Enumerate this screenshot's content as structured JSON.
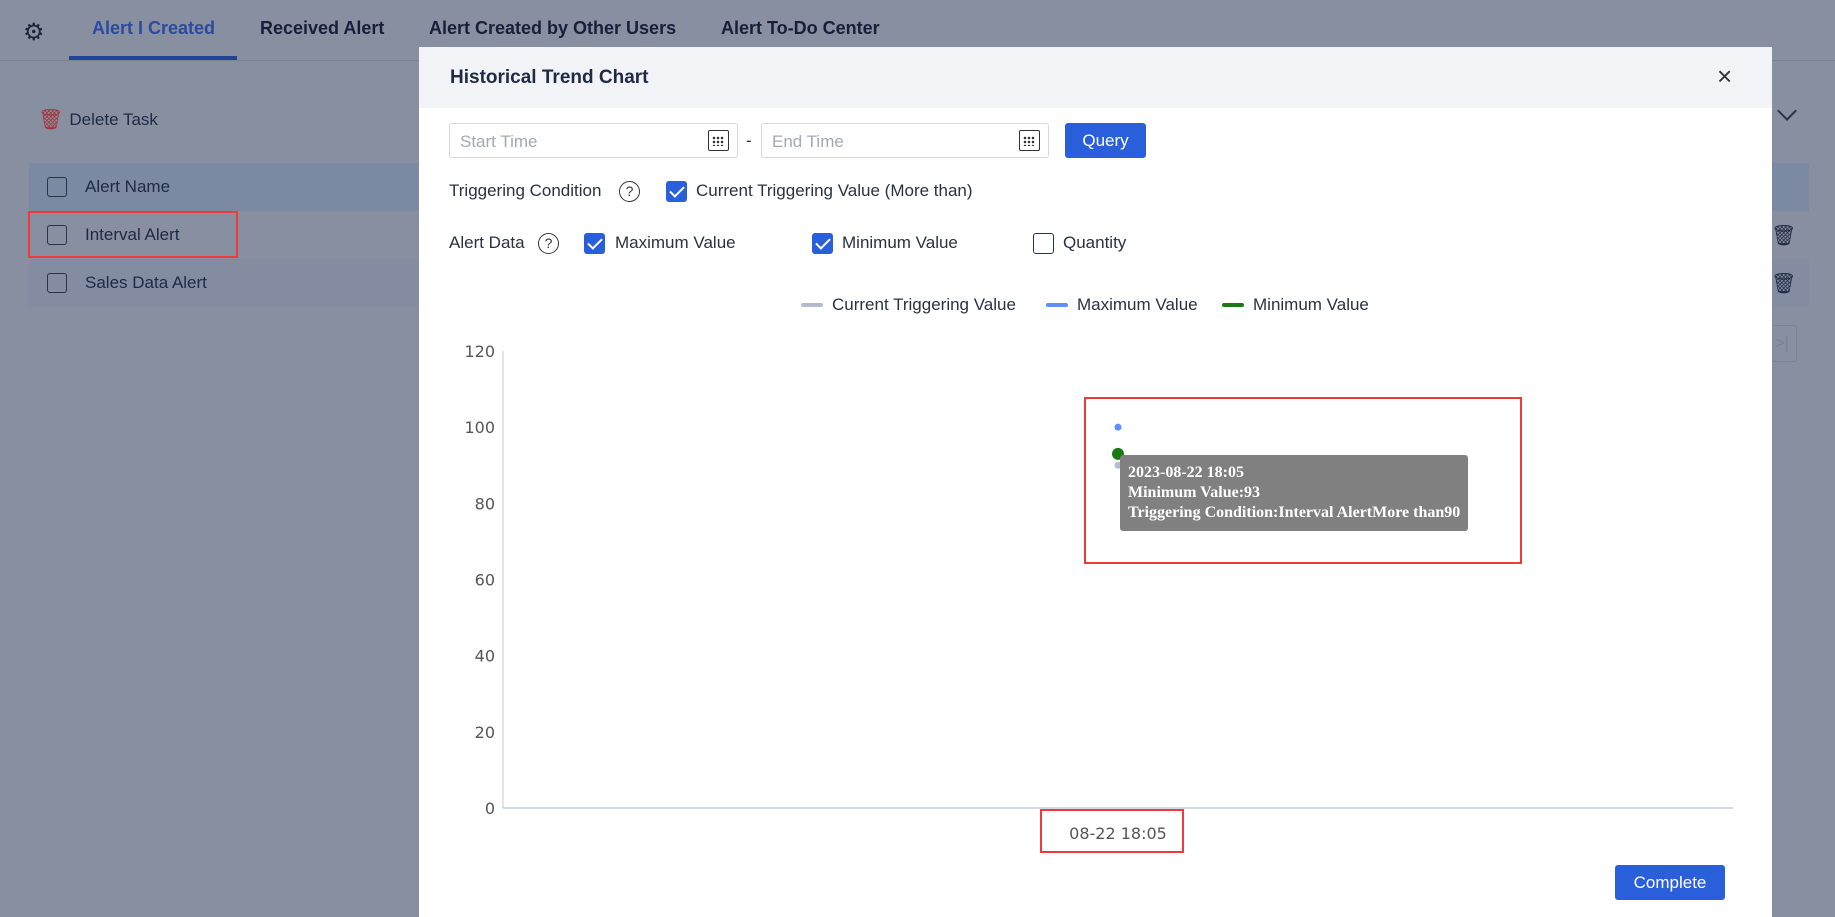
{
  "tabs": [
    {
      "label": "Alert I Created",
      "active": true
    },
    {
      "label": "Received Alert"
    },
    {
      "label": "Alert Created by Other Users"
    },
    {
      "label": "Alert To-Do Center"
    }
  ],
  "toolbar": {
    "delete_label": "Delete Task"
  },
  "table": {
    "header": "Alert Name",
    "rows": [
      "Interval Alert",
      "Sales Data Alert"
    ]
  },
  "modal": {
    "title": "Historical Trend Chart",
    "start_placeholder": "Start Time",
    "separator": "-",
    "end_placeholder": "End Time",
    "query_label": "Query",
    "triggering_label": "Triggering Condition",
    "triggering_option": {
      "label": "Current Triggering Value (More than)",
      "checked": true
    },
    "alert_data_label": "Alert Data",
    "alert_data_options": [
      {
        "label": "Maximum Value",
        "checked": true
      },
      {
        "label": "Minimum Value",
        "checked": true
      },
      {
        "label": "Quantity",
        "checked": false
      }
    ],
    "complete_label": "Complete"
  },
  "chart_data": {
    "type": "scatter",
    "x": [
      "08-22 18:05"
    ],
    "ylim": [
      0,
      120
    ],
    "yticks": [
      "0",
      "20",
      "40",
      "60",
      "80",
      "100",
      "120"
    ],
    "series": [
      {
        "name": "Current Triggering Value",
        "color": "#b4bccc",
        "values": [
          90
        ]
      },
      {
        "name": "Maximum Value",
        "color": "#5b8ff9",
        "values": [
          100
        ]
      },
      {
        "name": "Minimum Value",
        "color": "#1a7a12",
        "values": [
          93
        ]
      }
    ],
    "tooltip": {
      "line1": "2023-08-22 18:05",
      "line2": "Minimum Value:93",
      "line3": "Triggering Condition:Interval AlertMore than90"
    }
  }
}
